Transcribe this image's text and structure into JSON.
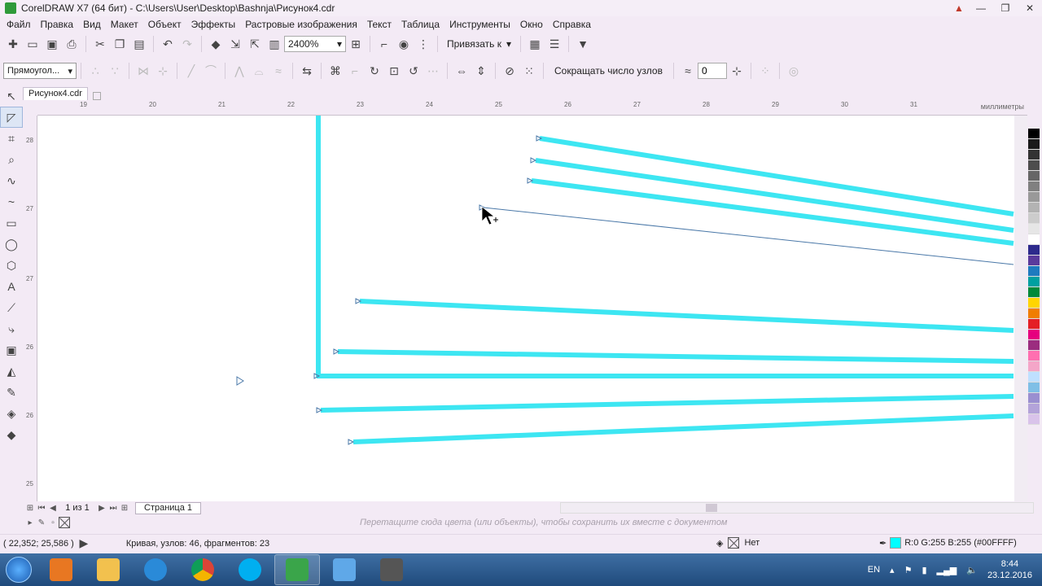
{
  "window": {
    "title": "CorelDRAW X7 (64 бит) - C:\\Users\\User\\Desktop\\Bashnja\\Рисунок4.cdr"
  },
  "menu": [
    "Файл",
    "Правка",
    "Вид",
    "Макет",
    "Объект",
    "Эффекты",
    "Растровые изображения",
    "Текст",
    "Таблица",
    "Инструменты",
    "Окно",
    "Справка"
  ],
  "toolbar": {
    "zoom": "2400%",
    "snap_label": "Привязать к"
  },
  "property_bar": {
    "shape_type": "Прямоугол...",
    "reduce_nodes_label": "Сокращать число узлов",
    "smoothing_value": "0"
  },
  "document_tab": "Рисунок4.cdr",
  "ruler": {
    "h_ticks": [
      "19",
      "20",
      "21",
      "22",
      "23",
      "24",
      "25",
      "26",
      "27",
      "28",
      "29",
      "30",
      "31"
    ],
    "v_ticks": [
      "28",
      "27",
      "27",
      "26",
      "26",
      "25"
    ],
    "units": "миллиметры"
  },
  "page_nav": {
    "count": "1 из 1",
    "page_tab": "Страница 1"
  },
  "color_dock_hint": "Перетащите сюда цвета (или объекты), чтобы сохранить их вместе с документом",
  "status": {
    "coords": "( 22,352; 25,586 )",
    "info": "Кривая, узлов: 46, фрагментов: 23",
    "fill": "Нет",
    "outline_color": "R:0 G:255 B:255 (#00FFFF)"
  },
  "colors": {
    "stroke": "#3de6f2",
    "accent": "#00ffff"
  },
  "palette": [
    "#000000",
    "#1a1a1a",
    "#333333",
    "#4d4d4d",
    "#666666",
    "#808080",
    "#999999",
    "#b3b3b3",
    "#cccccc",
    "#e6e6e6",
    "#ffffff",
    "#2d2a8c",
    "#5a3a9c",
    "#1e7bbf",
    "#00a0a0",
    "#008a3a",
    "#ffd500",
    "#f07d00",
    "#e41f26",
    "#e6007e",
    "#9b2d7f",
    "#ff6fb0",
    "#f4a6c8",
    "#bfe0ff",
    "#7fbfe6",
    "#9a8fd0",
    "#b3a3d9",
    "#d9c3ea"
  ],
  "taskbar": {
    "lang": "EN",
    "time": "8:44",
    "date": "23.12.2016"
  }
}
